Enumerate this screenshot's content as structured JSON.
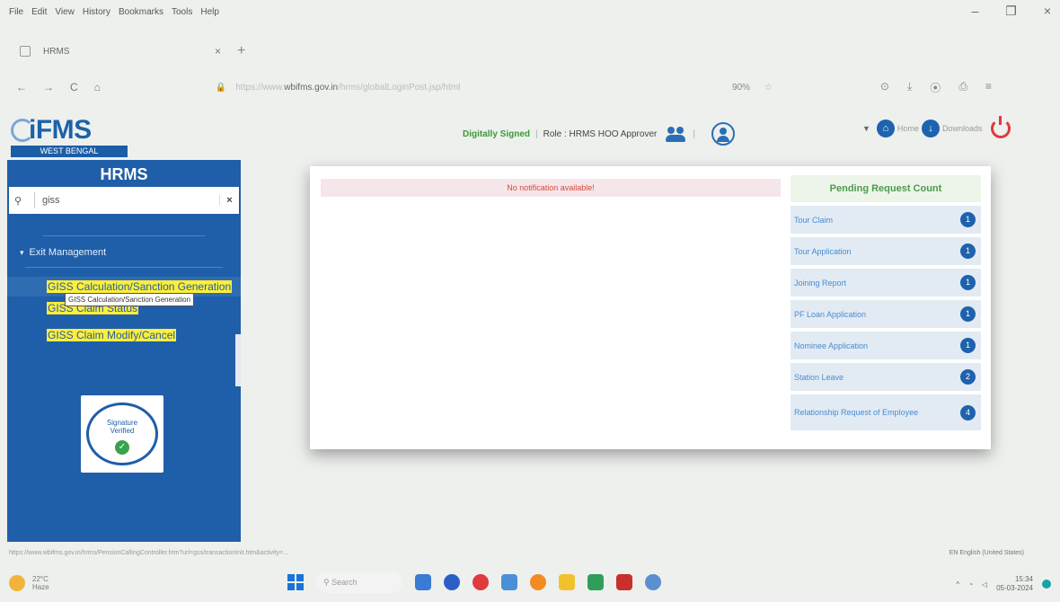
{
  "browser": {
    "menu": [
      "File",
      "Edit",
      "View",
      "History",
      "Bookmarks",
      "Tools",
      "Help"
    ],
    "window_controls": [
      "–",
      "❐",
      "×"
    ],
    "tab_title": "HRMS",
    "tab_close": "×",
    "new_tab": "+",
    "nav": {
      "back": "←",
      "forward": "→",
      "reload": "C",
      "home": "⌂"
    },
    "url_prefix": "https://www.",
    "url_domain": "wbifms.gov.in",
    "url_suffix": "/hrms/globalLoginPost.jsp/html",
    "zoom": "90%",
    "right_icons": [
      "⊙",
      "⤓",
      "⦿",
      "⎙",
      "≡"
    ]
  },
  "header": {
    "logo": "iFMS",
    "logo_sub": "WEST BENGAL",
    "digitally_signed": "Digitally Signed",
    "separator": "|",
    "role": "Role : HRMS HOO Approver",
    "dropdown_caret": "▼",
    "home_label": "Home",
    "downloads_label": "Downloads"
  },
  "sidebar": {
    "title": "HRMS",
    "search_value": "giss",
    "search_clear": "×",
    "parent_label": "Exit Management",
    "items": [
      {
        "label": "GISS Calculation/Sanction Generation"
      },
      {
        "label": "GISS Claim Status"
      },
      {
        "label": "GISS Claim Modify/Cancel"
      }
    ],
    "tooltip": "GISS Calculation/Sanction Generation",
    "signature_line1": "Signature",
    "signature_line2": "Verified"
  },
  "main": {
    "notification": "No notification available!",
    "pending_title": "Pending Request Count",
    "pending": [
      {
        "label": "Tour Claim",
        "count": "1"
      },
      {
        "label": "Tour Application",
        "count": "1"
      },
      {
        "label": "Joining Report",
        "count": "1"
      },
      {
        "label": "PF Loan Application",
        "count": "1"
      },
      {
        "label": "Nominee Application",
        "count": "1"
      },
      {
        "label": "Station Leave",
        "count": "2"
      },
      {
        "label": "Relationship Request of Employee",
        "count": "4"
      }
    ]
  },
  "status": {
    "url": "https://www.wbifms.gov.in/hrms/PensionCallingController.htm?url=gss/transactionInit.htm&activity=...",
    "language": "EN English (United States)"
  },
  "taskbar": {
    "temp": "22°C",
    "weather": "Haze",
    "search": "Search",
    "time": "15:34",
    "date": "05-03-2024"
  },
  "colors": {
    "accent": "#1f5ea8",
    "highlight": "#ffee3a",
    "signed": "#3a9a3a",
    "notification": "#d14b3a"
  }
}
